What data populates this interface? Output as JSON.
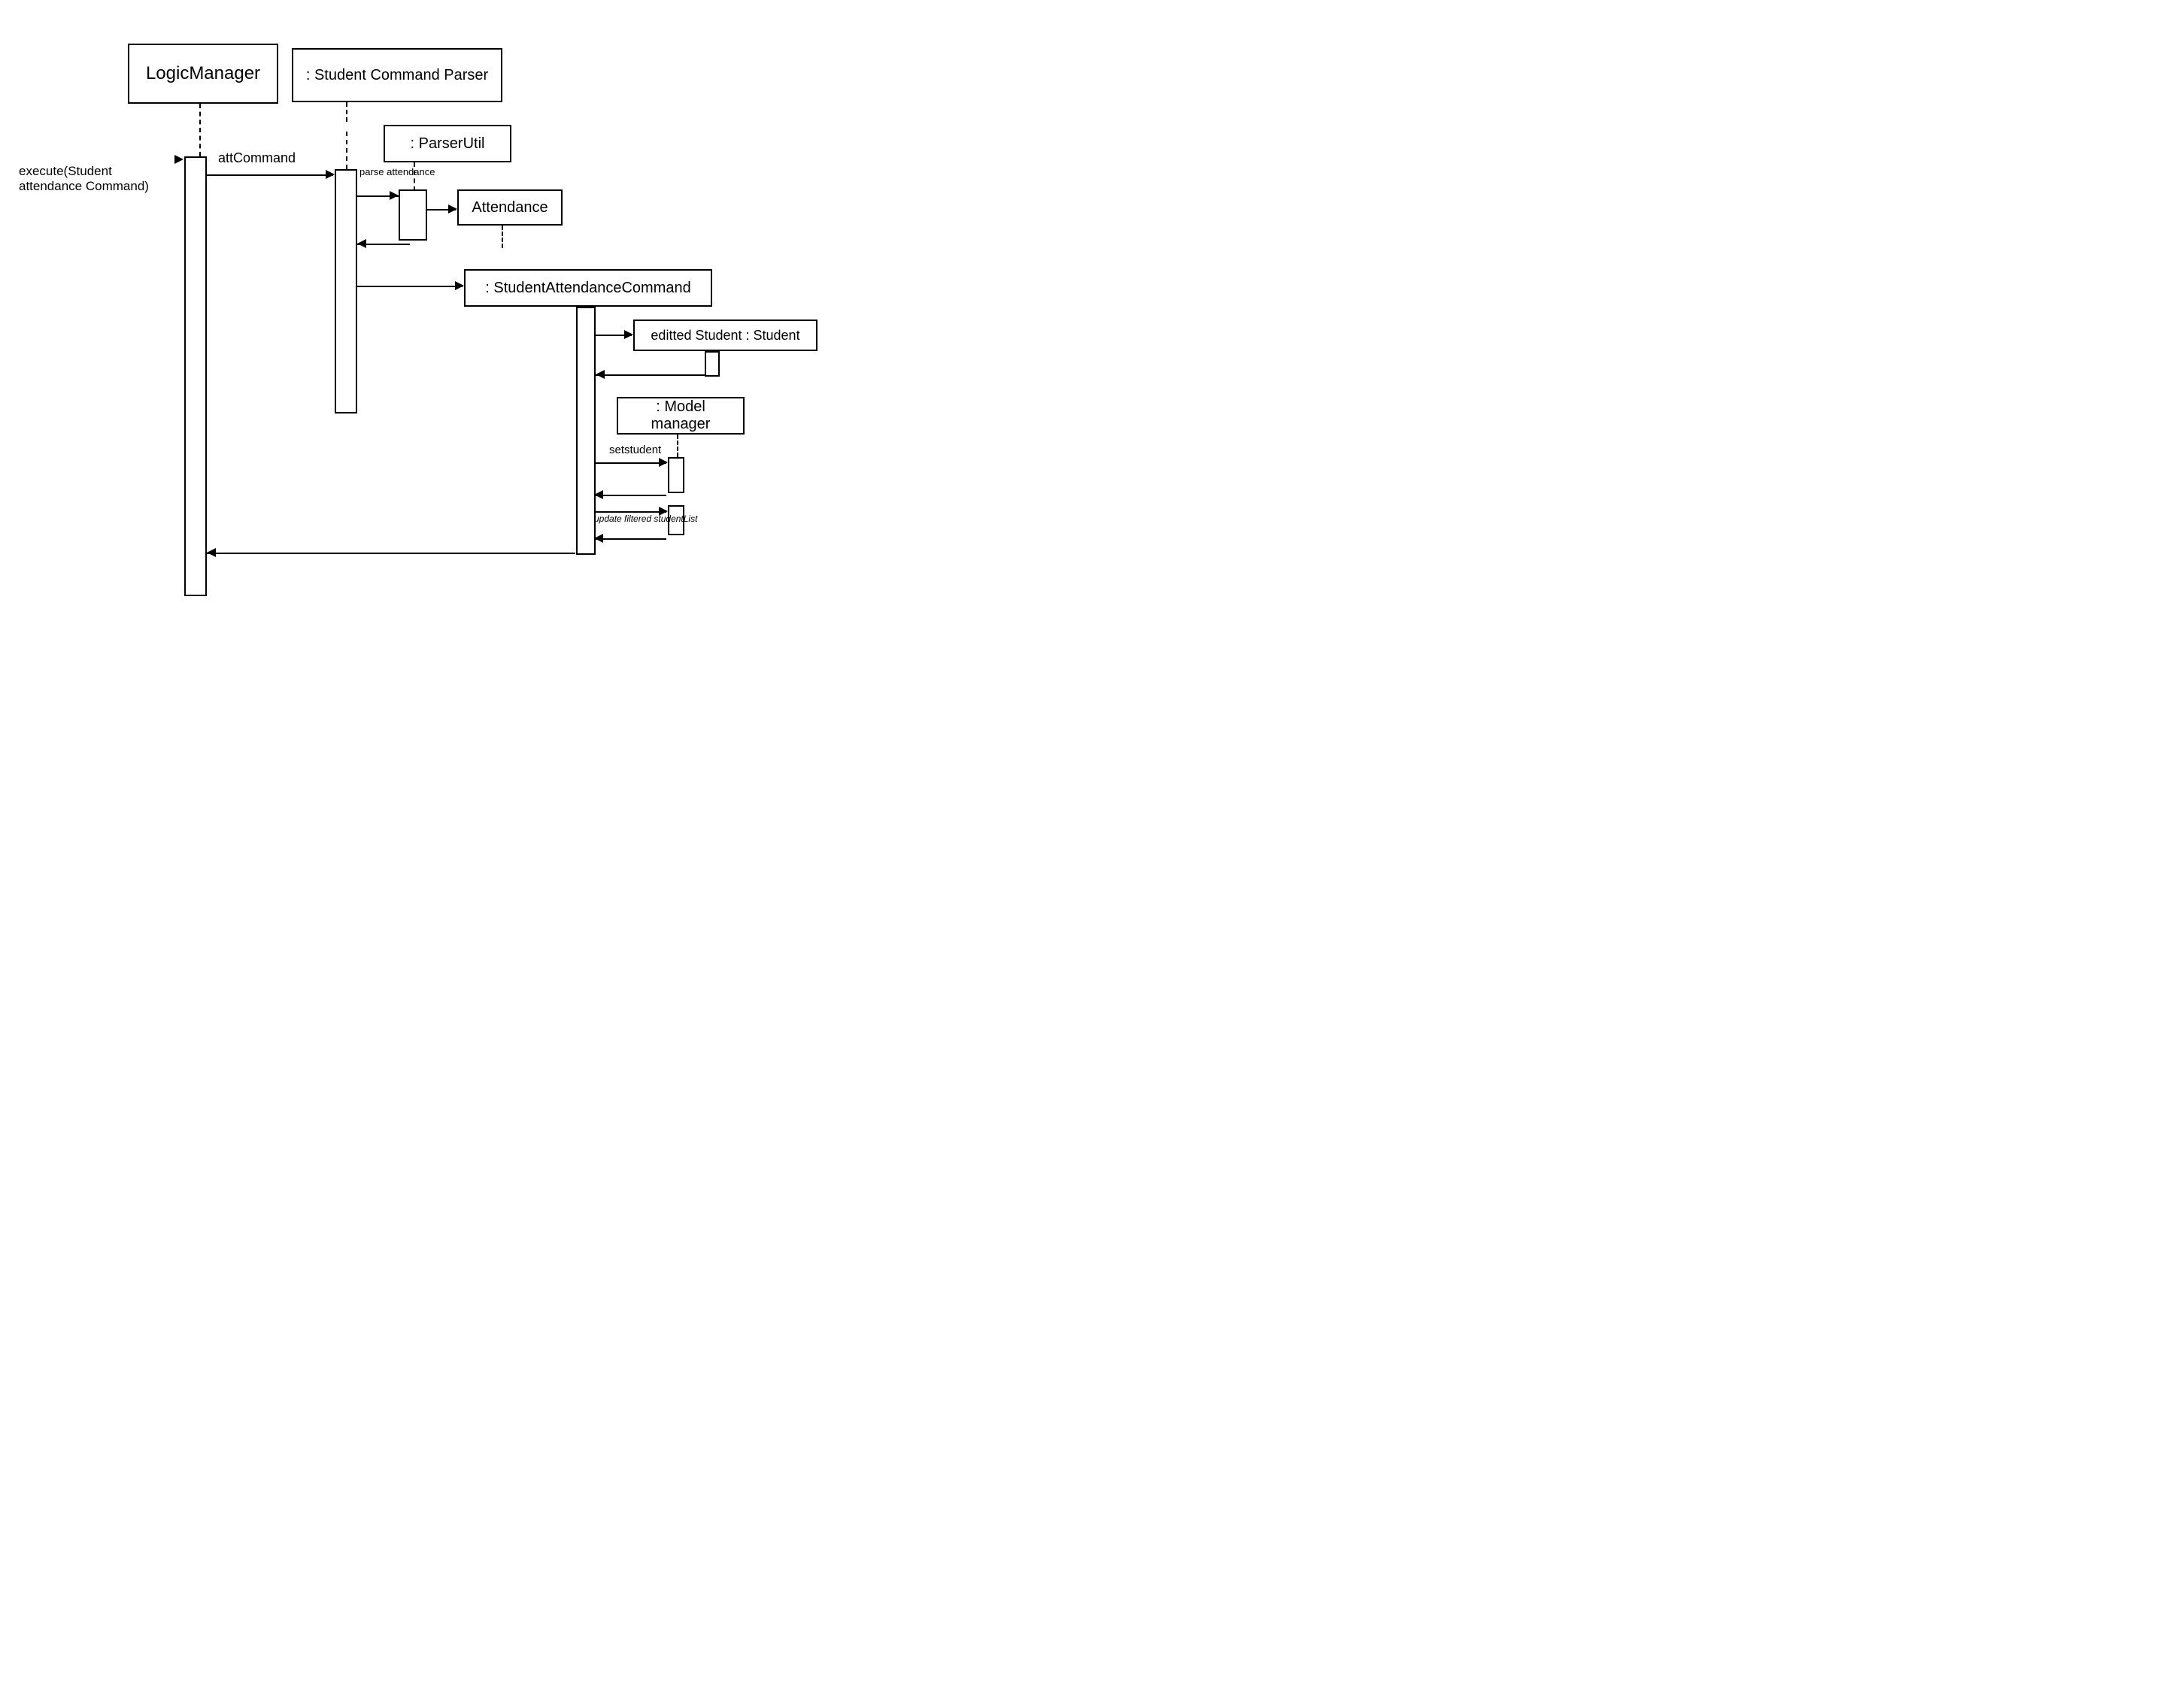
{
  "participants": {
    "logic_manager": "LogicManager",
    "student_command_parser": ": Student Command Parser",
    "parser_util": ": ParserUtil",
    "attendance": "Attendance",
    "student_attendance_command": ": StudentAttendanceCommand",
    "edited_student": "editted Student : Student",
    "model_manager": ": Model manager"
  },
  "messages": {
    "execute": "execute(Student attendance Command)",
    "att_command": "attCommand",
    "parse_attendance": "parse attendance",
    "set_student": "setstudent",
    "update_filtered": "update filtered studentList"
  }
}
